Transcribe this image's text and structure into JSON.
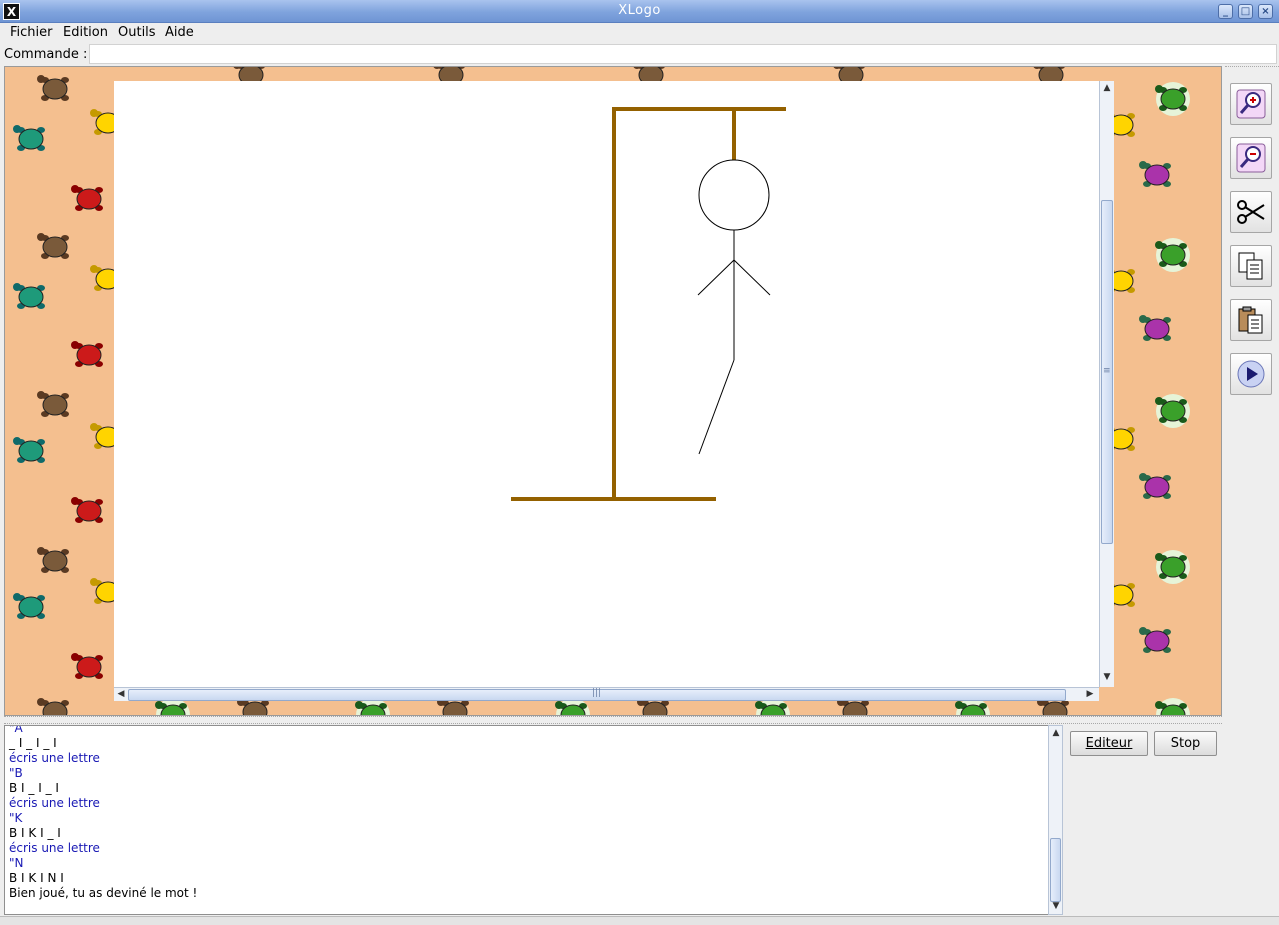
{
  "window": {
    "title": "XLogo",
    "app_icon": "X"
  },
  "menubar": {
    "items": [
      "Fichier",
      "Edition",
      "Outils",
      "Aide"
    ]
  },
  "command": {
    "label": "Commande :",
    "value": ""
  },
  "toolbar": {
    "buttons": [
      {
        "name": "zoom-in-icon"
      },
      {
        "name": "zoom-out-icon"
      },
      {
        "name": "cut-icon"
      },
      {
        "name": "copy-icon"
      },
      {
        "name": "paste-icon"
      },
      {
        "name": "play-icon"
      }
    ]
  },
  "history": {
    "lines": [
      {
        "text": "\"A",
        "color": "blue"
      },
      {
        "text": "_ I _ I _ I",
        "color": "black"
      },
      {
        "text": "écris une lettre",
        "color": "blue"
      },
      {
        "text": "\"B",
        "color": "blue"
      },
      {
        "text": "B I _ I _ I",
        "color": "black"
      },
      {
        "text": "écris une lettre",
        "color": "blue"
      },
      {
        "text": "\"K",
        "color": "blue"
      },
      {
        "text": "B I K I _ I",
        "color": "black"
      },
      {
        "text": "écris une lettre",
        "color": "blue"
      },
      {
        "text": "\"N",
        "color": "blue"
      },
      {
        "text": "B I K I N I",
        "color": "black"
      },
      {
        "text": "Bien joué, tu as deviné le mot !",
        "color": "black"
      }
    ]
  },
  "buttons": {
    "editor": "Editeur",
    "stop": "Stop"
  },
  "colors": {
    "gallows": "#946100",
    "background": "#f4bf8f",
    "history_blue": "#1818b4"
  }
}
